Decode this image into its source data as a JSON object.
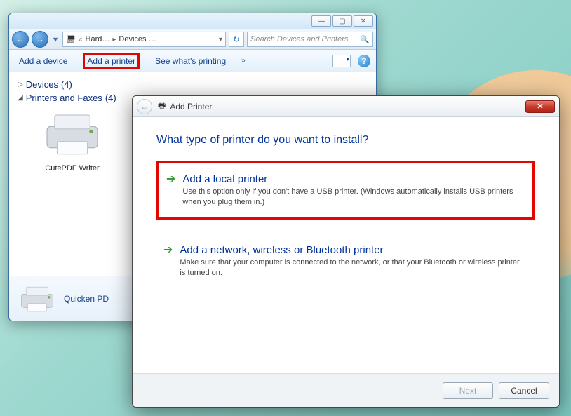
{
  "bg_window": {
    "titlebar": {
      "minimize": "—",
      "maximize": "▢",
      "close": "✕"
    },
    "address": {
      "crumb_prefix": "«",
      "crumb1": "Hard…",
      "crumb2": "Devices …",
      "crumb_sep": "▸",
      "refresh_icon": "↻"
    },
    "search_placeholder": "Search Devices and Printers",
    "toolbar": {
      "add_device": "Add a device",
      "add_printer": "Add a printer",
      "see_printing": "See what's printing",
      "overflow": "»",
      "help": "?"
    },
    "groups": {
      "devices": {
        "label": "Devices",
        "count": "(4)",
        "expanded": false
      },
      "printers": {
        "label": "Printers and Faxes",
        "count": "(4)",
        "expanded": true
      }
    },
    "items": {
      "printer1_label": "CutePDF Writer"
    },
    "footer": {
      "selected_label": "Quicken PD"
    }
  },
  "dialog": {
    "title": "Add Printer",
    "question": "What type of printer do you want to install?",
    "option1": {
      "title": "Add a local printer",
      "desc": "Use this option only if you don't have a USB printer. (Windows automatically installs USB printers when you plug them in.)"
    },
    "option2": {
      "title": "Add a network, wireless or Bluetooth printer",
      "desc": "Make sure that your computer is connected to the network, or that your Bluetooth or wireless printer is turned on."
    },
    "buttons": {
      "next": "Next",
      "cancel": "Cancel"
    }
  }
}
